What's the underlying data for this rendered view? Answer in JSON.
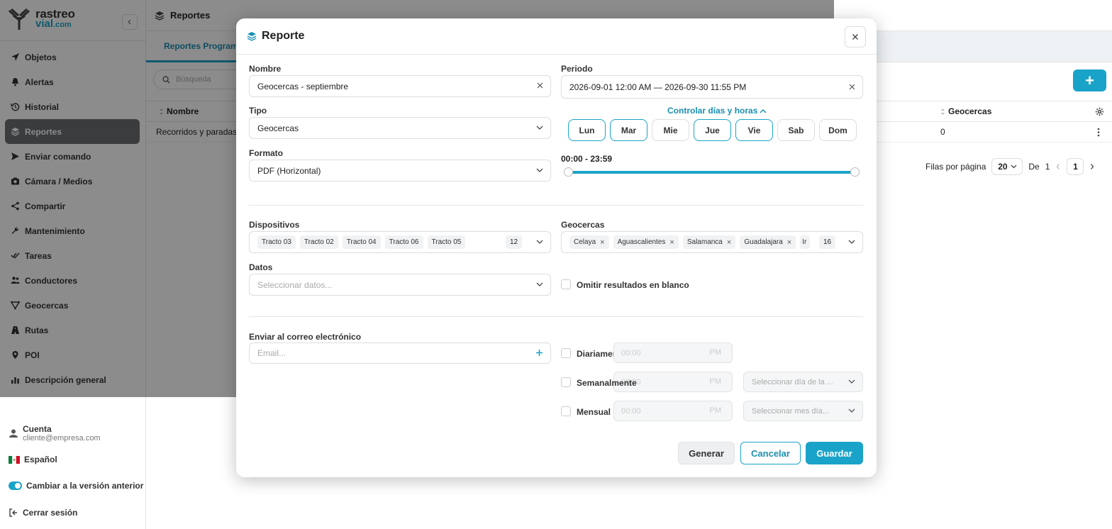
{
  "app": {
    "logo_line1": "rastreo",
    "logo_line2": "vial",
    "logo_suffix": ".com"
  },
  "sidebar": {
    "items": [
      {
        "label": "Objetos",
        "icon": "navigation-icon"
      },
      {
        "label": "Alertas",
        "icon": "bell-icon"
      },
      {
        "label": "Historial",
        "icon": "history-icon"
      },
      {
        "label": "Reportes",
        "icon": "layers-icon",
        "active": true
      },
      {
        "label": "Enviar comando",
        "icon": "send-icon"
      },
      {
        "label": "Cámara / Medios",
        "icon": "camera-icon"
      },
      {
        "label": "Compartir",
        "icon": "share-icon"
      },
      {
        "label": "Mantenimiento",
        "icon": "wrench-icon"
      },
      {
        "label": "Tareas",
        "icon": "checks-icon"
      },
      {
        "label": "Conductores",
        "icon": "users-icon"
      },
      {
        "label": "Geocercas",
        "icon": "geofence-icon"
      },
      {
        "label": "Rutas",
        "icon": "road-icon"
      },
      {
        "label": "POI",
        "icon": "pin-icon"
      },
      {
        "label": "Descripción general",
        "icon": "chart-icon"
      }
    ],
    "account_label": "Cuenta",
    "account_email": "cliente@empresa.com",
    "language": "Español",
    "legacy_toggle": "Cambiar a la versión anterior",
    "logout": "Cerrar sesión"
  },
  "page": {
    "title": "Reportes",
    "tab": "Reportes Programados",
    "search_placeholder": "Búsqueda",
    "col_name": "Nombre",
    "col_geofences": "Geocercas",
    "row_name": "Recorridos y paradas -",
    "row_geofences": "0",
    "rows_per_page_label": "Filas por página",
    "rows_per_page": "20",
    "of_label": "De",
    "total_pages": "1",
    "current_page": "1"
  },
  "modal": {
    "title": "Reporte",
    "name_label": "Nombre",
    "name_value": "Geocercas - septiembre",
    "period_label": "Periodo",
    "period_value": "2026-09-01 12:00 AM — 2026-09-30 11:55 PM",
    "type_label": "Tipo",
    "type_value": "Geocercas",
    "control_link": "Controlar días y horas",
    "days": [
      {
        "label": "Lun",
        "on": true
      },
      {
        "label": "Mar",
        "on": true
      },
      {
        "label": "Mie",
        "on": false
      },
      {
        "label": "Jue",
        "on": true
      },
      {
        "label": "Vie",
        "on": true
      },
      {
        "label": "Sab",
        "on": false
      },
      {
        "label": "Dom",
        "on": false
      }
    ],
    "format_label": "Formato",
    "format_value": "PDF (Horizontal)",
    "time_range": "00:00 - 23:59",
    "devices_label": "Dispositivos",
    "devices": [
      "Tracto 03",
      "Tracto 02",
      "Tracto 04",
      "Tracto 06",
      "Tracto 05"
    ],
    "devices_count": "12",
    "geofences_label": "Geocercas",
    "geofences": [
      "Celaya",
      "Aguascalientes",
      "Salamanca",
      "Guadalajara"
    ],
    "geofences_truncated": "Ir",
    "geofences_count": "16",
    "data_label": "Datos",
    "data_placeholder": "Seleccionar datos...",
    "omit_label": "Omitir resultados en blanco",
    "email_label": "Enviar al correo electrónico",
    "email_placeholder": "Email...",
    "daily_label": "Diariamente",
    "weekly_label": "Semanalmente",
    "monthly_label": "Mensual",
    "time_placeholder": "00:00",
    "pm": "PM",
    "weekday_placeholder": "Seleccionar día de la ...",
    "monthday_placeholder": "Seleccionar mes día...",
    "btn_generate": "Generar",
    "btn_cancel": "Cancelar",
    "btn_save": "Guardar"
  },
  "colors": {
    "accent": "#1aa3c8",
    "active_nav": "#6a6d72"
  }
}
